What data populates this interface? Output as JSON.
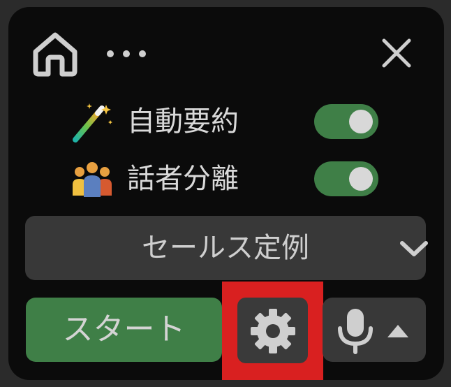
{
  "header": {
    "home_icon": "home-icon",
    "more_icon": "more-horizontal-icon",
    "close_icon": "close-icon"
  },
  "options": [
    {
      "icon": "magic-wand-icon",
      "label": "自動要約",
      "enabled": true
    },
    {
      "icon": "people-icon",
      "label": "話者分離",
      "enabled": true
    }
  ],
  "meeting_type": {
    "selected": "セールス定例",
    "icon": "chevron-down-icon"
  },
  "controls": {
    "start_label": "スタート",
    "settings_icon": "gear-icon",
    "mic_icon": "microphone-icon",
    "mic_menu_icon": "triangle-up-icon"
  },
  "colors": {
    "panel": "#0b0b0b",
    "accent_green": "#3f7f47",
    "button_gray": "#383838",
    "highlight_red": "#d92020",
    "text": "#d9d9d9"
  }
}
